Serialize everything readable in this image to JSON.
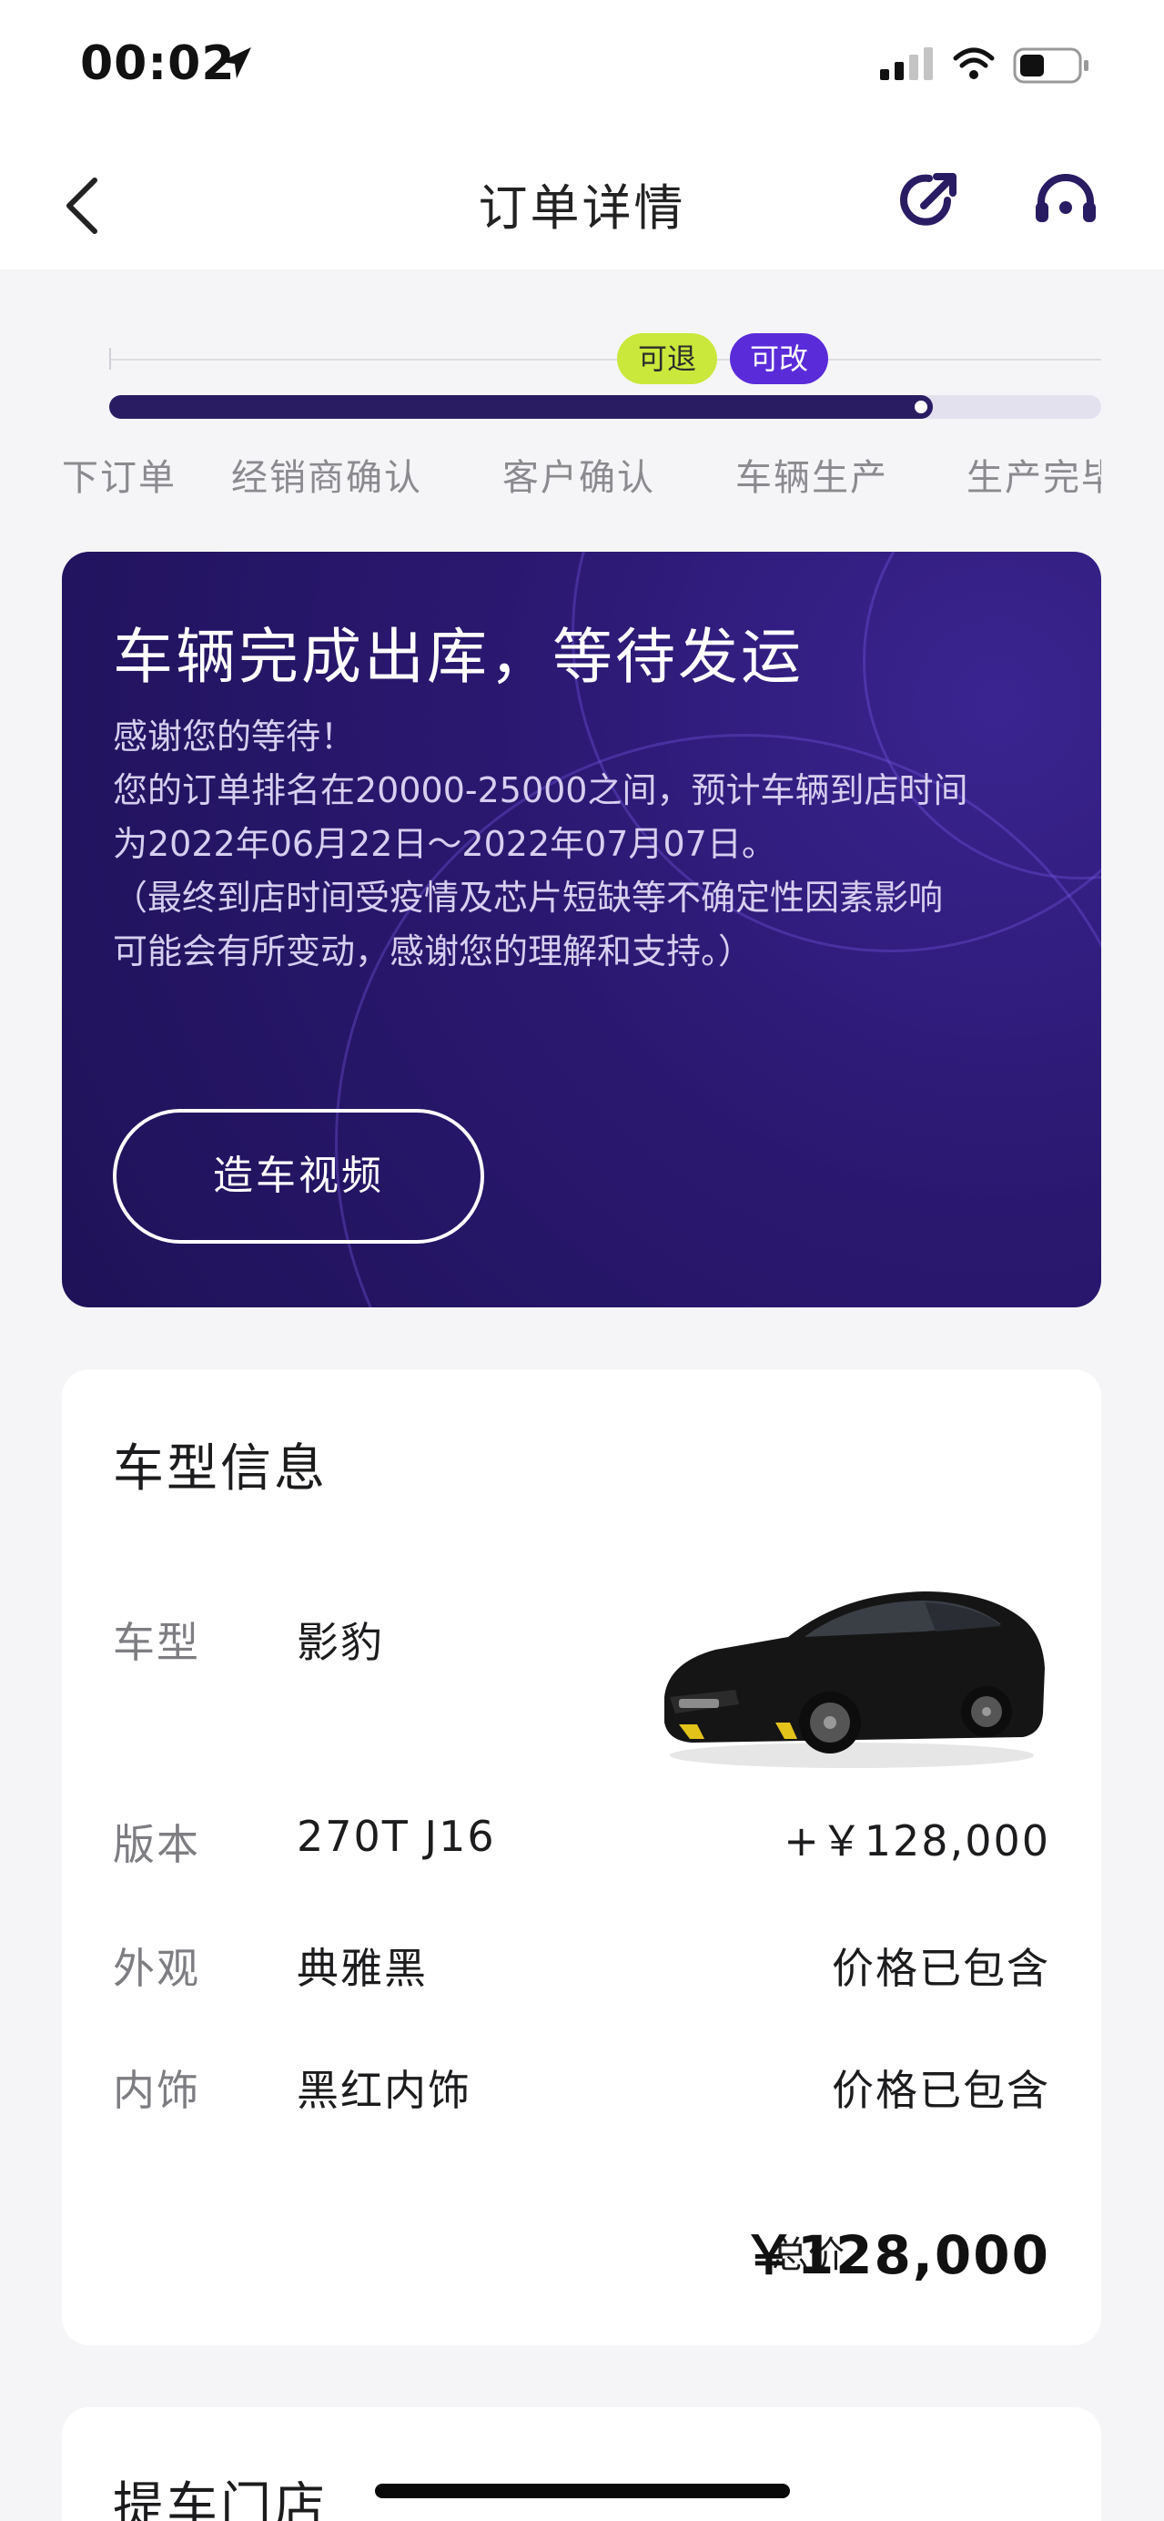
{
  "status_bar": {
    "time": "00:02"
  },
  "nav": {
    "title": "订单详情"
  },
  "progress": {
    "badges": {
      "refundable": "可退",
      "modifiable": "可改"
    },
    "steps": [
      "下订单",
      "经销商确认",
      "客户确认",
      "车辆生产",
      "生产完毕"
    ],
    "fill_fraction": 0.83
  },
  "banner": {
    "title": "车辆完成出库，等待发运",
    "lines": [
      "感谢您的等待！",
      "您的订单排名在20000-25000之间，预计车辆到店时间",
      "为2022年06月22日～2022年07月07日。",
      "（最终到店时间受疫情及芯片短缺等不确定性因素影响",
      "可能会有所变动，感谢您的理解和支持。）"
    ],
    "video_button": "造车视频"
  },
  "car_info": {
    "title": "车型信息",
    "rows": [
      {
        "label": "车型",
        "value": "影豹",
        "price": ""
      },
      {
        "label": "版本",
        "value": "270T J16",
        "price": "+￥128,000"
      },
      {
        "label": "外观",
        "value": "典雅黑",
        "price": "价格已包含"
      },
      {
        "label": "内饰",
        "value": "黑红内饰",
        "price": "价格已包含"
      }
    ],
    "total_label": "总价",
    "total_value": "￥128,000"
  },
  "pickup_store": {
    "title": "提车门店"
  },
  "colors": {
    "accent_dark": "#2a1c63",
    "accent_purple": "#5a2bd9",
    "badge_green": "#c9e83b",
    "background": "#f5f5f7"
  }
}
